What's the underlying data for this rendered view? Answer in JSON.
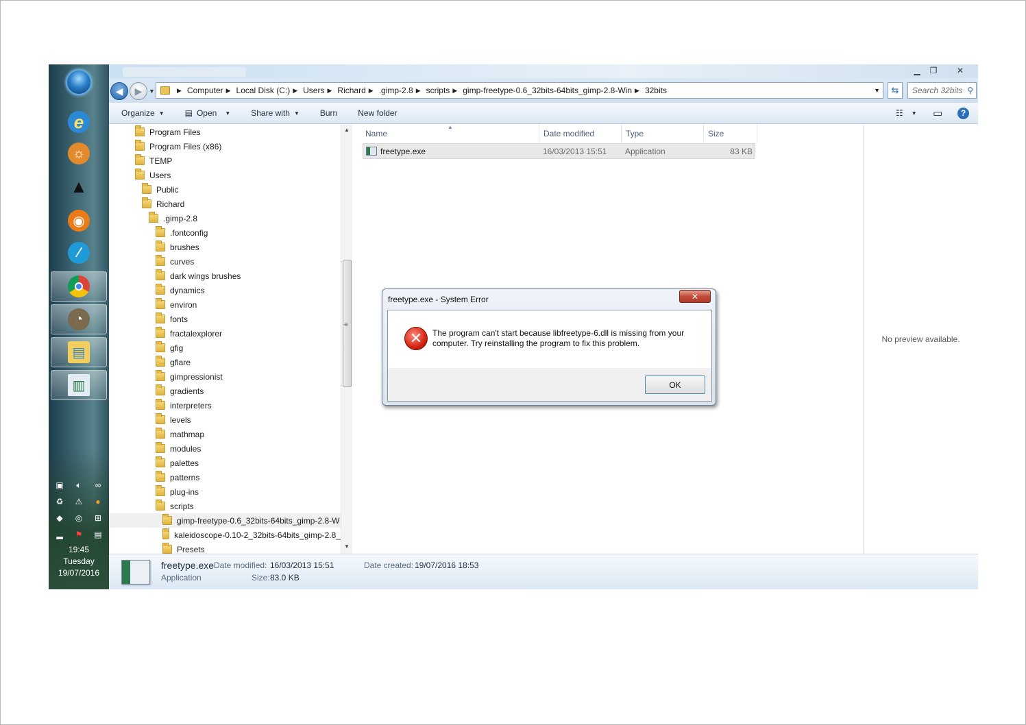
{
  "taskbar": {
    "apps": [
      {
        "name": "internet-explorer",
        "glyph": "e"
      },
      {
        "name": "paint",
        "glyph": "☼"
      },
      {
        "name": "inkscape",
        "glyph": "▲"
      },
      {
        "name": "blender",
        "glyph": "◉"
      },
      {
        "name": "app",
        "glyph": "∕"
      },
      {
        "name": "chrome",
        "glyph": ""
      },
      {
        "name": "gimp",
        "glyph": "◔"
      },
      {
        "name": "explorer",
        "glyph": "▤"
      },
      {
        "name": "freetype-app",
        "glyph": "▥"
      }
    ],
    "clock": {
      "time": "19:45",
      "day": "Tuesday",
      "date": "19/07/2016"
    }
  },
  "window": {
    "address": {
      "crumbs": [
        "Computer",
        "Local Disk (C:)",
        "Users",
        "Richard",
        ".gimp-2.8",
        "scripts",
        "gimp-freetype-0.6_32bits-64bits_gimp-2.8-Win",
        "32bits"
      ]
    },
    "search": {
      "placeholder": "Search 32bits"
    },
    "toolbar": {
      "organize": "Organize",
      "open": "Open",
      "share": "Share with",
      "burn": "Burn",
      "new_folder": "New folder"
    },
    "tree": [
      {
        "label": "Program Files",
        "indent": 0
      },
      {
        "label": "Program Files (x86)",
        "indent": 0
      },
      {
        "label": "TEMP",
        "indent": 0
      },
      {
        "label": "Users",
        "indent": 0
      },
      {
        "label": "Public",
        "indent": 1
      },
      {
        "label": "Richard",
        "indent": 1
      },
      {
        "label": ".gimp-2.8",
        "indent": 2
      },
      {
        "label": ".fontconfig",
        "indent": 3
      },
      {
        "label": "brushes",
        "indent": 3
      },
      {
        "label": "curves",
        "indent": 3
      },
      {
        "label": "dark wings brushes",
        "indent": 3
      },
      {
        "label": "dynamics",
        "indent": 3
      },
      {
        "label": "environ",
        "indent": 3
      },
      {
        "label": "fonts",
        "indent": 3
      },
      {
        "label": "fractalexplorer",
        "indent": 3
      },
      {
        "label": "gfig",
        "indent": 3
      },
      {
        "label": "gflare",
        "indent": 3
      },
      {
        "label": "gimpressionist",
        "indent": 3
      },
      {
        "label": "gradients",
        "indent": 3
      },
      {
        "label": "interpreters",
        "indent": 3
      },
      {
        "label": "levels",
        "indent": 3
      },
      {
        "label": "mathmap",
        "indent": 3
      },
      {
        "label": "modules",
        "indent": 3
      },
      {
        "label": "palettes",
        "indent": 3
      },
      {
        "label": "patterns",
        "indent": 3
      },
      {
        "label": "plug-ins",
        "indent": 3
      },
      {
        "label": "scripts",
        "indent": 3
      },
      {
        "label": "gimp-freetype-0.6_32bits-64bits_gimp-2.8-W",
        "indent": 4,
        "selected": true
      },
      {
        "label": "kaleidoscope-0.10-2_32bits-64bits_gimp-2.8_",
        "indent": 4
      },
      {
        "label": "Presets",
        "indent": 4
      }
    ],
    "columns": {
      "name": "Name",
      "date": "Date modified",
      "type": "Type",
      "size": "Size"
    },
    "files": [
      {
        "name": "freetype.exe",
        "date": "16/03/2013 15:51",
        "type": "Application",
        "size": "83 KB"
      }
    ],
    "preview": {
      "text": "No preview available."
    },
    "details": {
      "filename": "freetype.exe",
      "kind": "Application",
      "date_modified_label": "Date modified:",
      "date_modified": "16/03/2013 15:51",
      "size_label": "Size:",
      "size": "83.0 KB",
      "date_created_label": "Date created:",
      "date_created": "19/07/2016 18:53"
    }
  },
  "dialog": {
    "title": "freetype.exe - System Error",
    "message": "The program can't start because libfreetype-6.dll is missing from your computer. Try reinstalling the program to fix this problem.",
    "ok": "OK",
    "close_glyph": "✕"
  },
  "colors": {
    "error": "#d62514",
    "accent": "#3c7fb1",
    "taskbar": "#3f6774"
  }
}
